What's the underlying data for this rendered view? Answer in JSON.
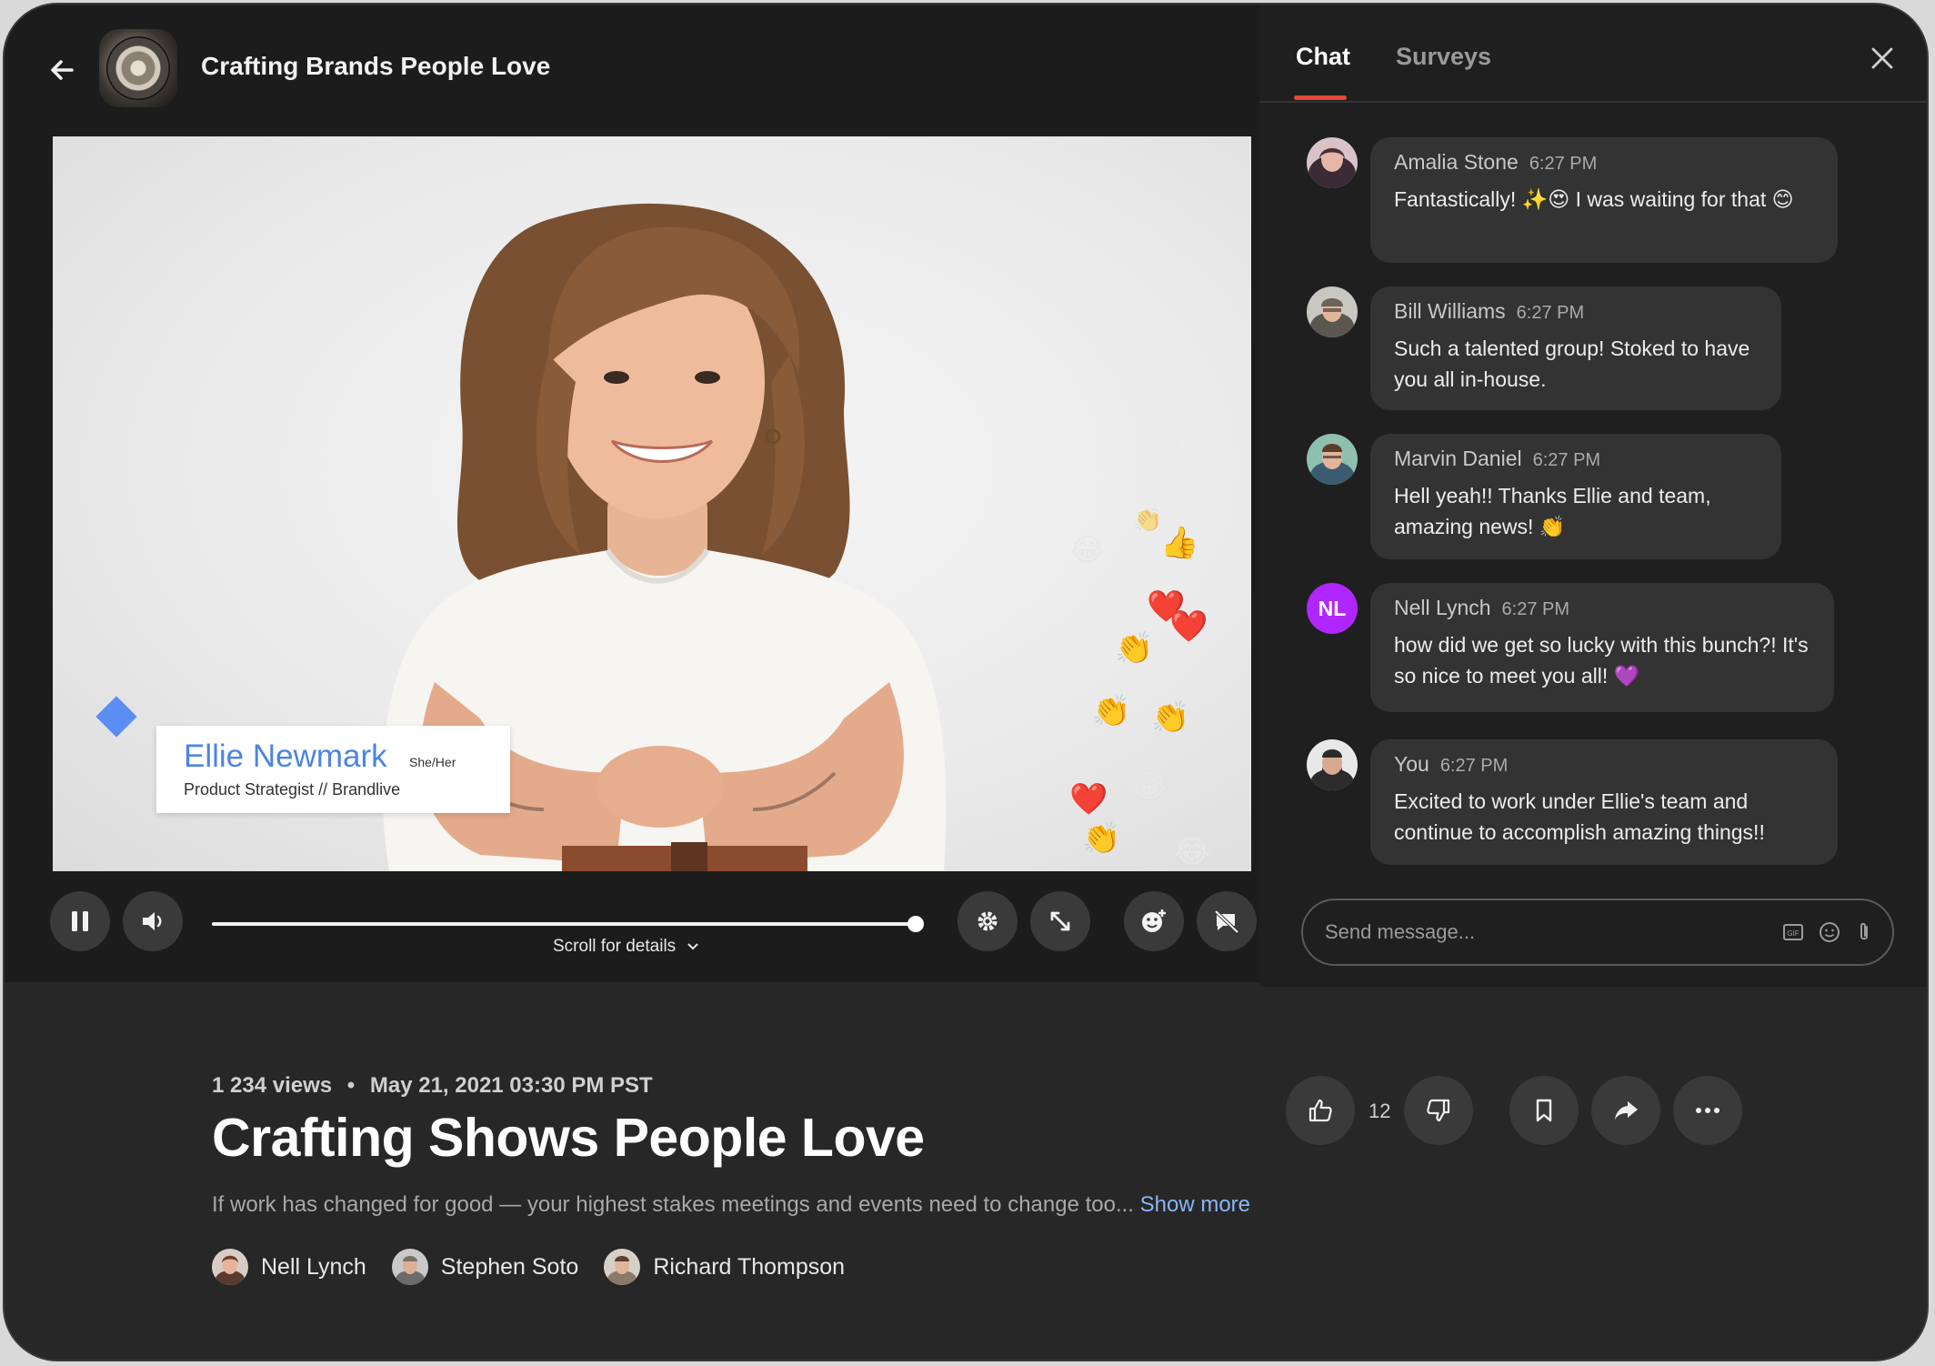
{
  "header": {
    "channel_title": "Crafting Brands People Love"
  },
  "video": {
    "lower_third": {
      "name": "Ellie Newmark",
      "pronouns": "She/Her",
      "role": "Product Strategist // Brandlive"
    },
    "reactions": [
      "😂",
      "👍",
      "❤️",
      "👏",
      "❤️",
      "👏",
      "👏",
      "😂",
      "❤️",
      "😂",
      "👏",
      "😂",
      "👏",
      "😂"
    ]
  },
  "controls": {
    "progress": 1.0,
    "scroll_hint": "Scroll for details"
  },
  "chat": {
    "tabs": [
      "Chat",
      "Surveys"
    ],
    "active_tab": "Chat",
    "messages": [
      {
        "name": "Amalia Stone",
        "time": "6:27 PM",
        "text": "Fantastically! ✨😍 I was waiting for that 😊"
      },
      {
        "name": "Bill Williams",
        "time": "6:27 PM",
        "text": "Such a talented group! Stoked to have you all in-house."
      },
      {
        "name": "Marvin Daniel",
        "time": "6:27 PM",
        "text": "Hell yeah!! Thanks Ellie and team, amazing news! 👏"
      },
      {
        "name": "Nell Lynch",
        "time": "6:27 PM",
        "text": "how did we get so lucky with this bunch?! It's so nice to meet you all! 💜",
        "initials": "NL"
      },
      {
        "name": "You",
        "time": "6:27 PM",
        "text": "Excited to work under Ellie's team and continue to accomplish amazing things!!"
      }
    ],
    "input_placeholder": "Send message..."
  },
  "details": {
    "views": "1 234 views",
    "separator": "•",
    "date": "May 21, 2021 03:30 PM PST",
    "title": "Crafting Shows People Love",
    "description": "If work has changed for good — your highest stakes meetings and events need to change too...",
    "show_more": "Show more",
    "speakers": [
      "Nell Lynch",
      "Stephen Soto",
      "Richard Thompson"
    ],
    "like_count": "12"
  },
  "colors": {
    "accent_tab": "#e34a3a",
    "link": "#8ab4f8",
    "lower_third_name": "#4b84e6",
    "nl_avatar": "#b026ff"
  }
}
